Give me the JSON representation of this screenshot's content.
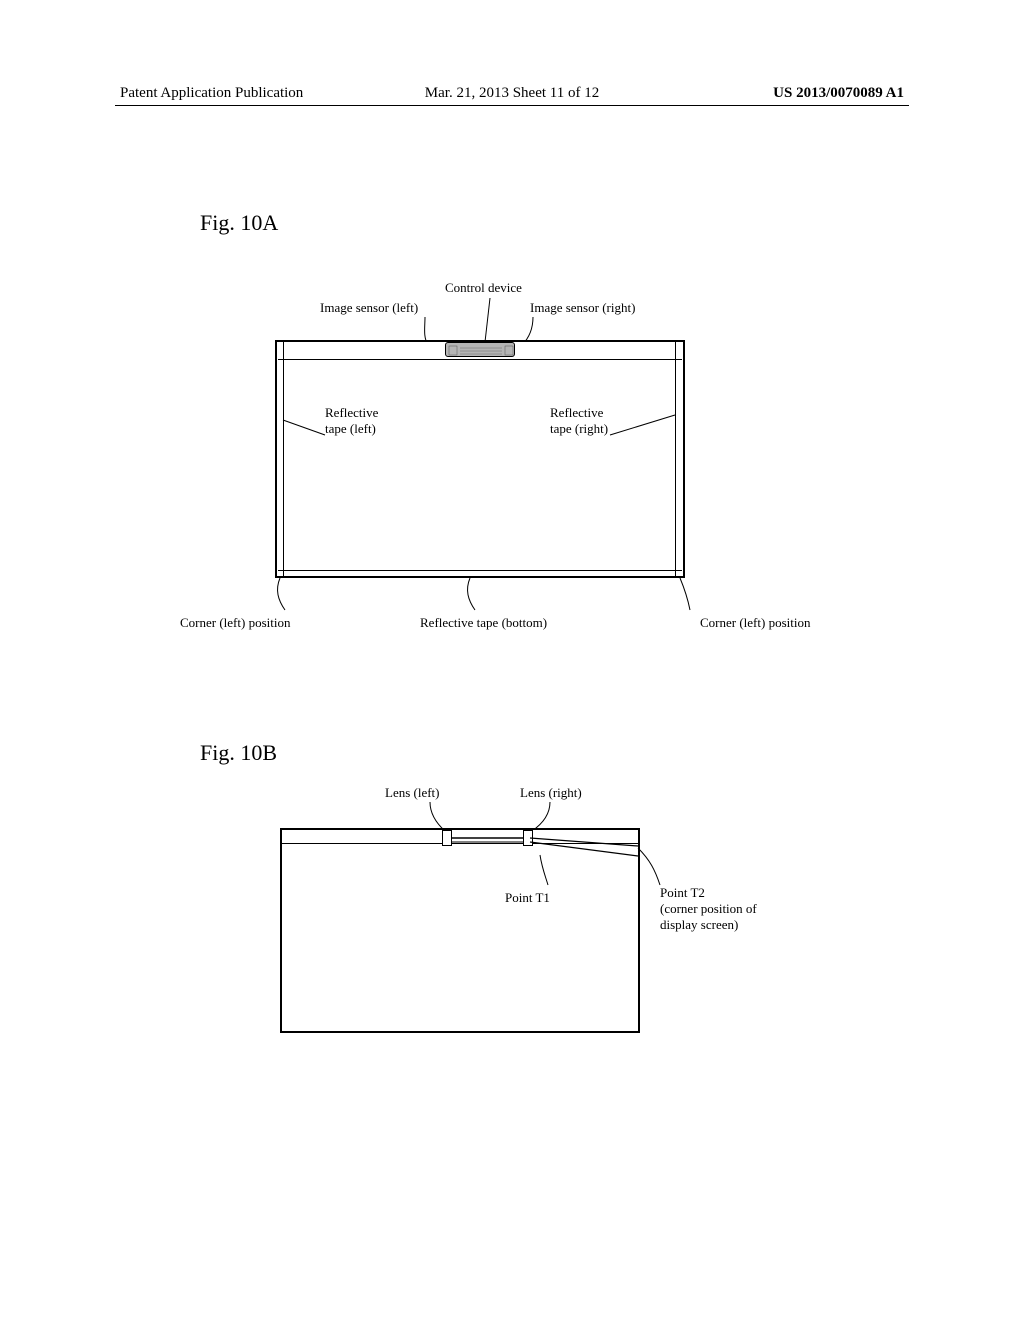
{
  "header": {
    "left": "Patent Application Publication",
    "center": "Mar. 21, 2013  Sheet 11 of 12",
    "right": "US 2013/0070089 A1"
  },
  "figA": {
    "title": "Fig. 10A",
    "labels": {
      "controlDevice": "Control device",
      "imageSensorLeft": "Image sensor (left)",
      "imageSensorRight": "Image sensor (right)",
      "reflectiveTapeLeft": "Reflective\ntape (left)",
      "reflectiveTapeRight": "Reflective\ntape (right)",
      "cornerLeftPosition": "Corner (left) position",
      "reflectiveTapeBottom": "Reflective tape (bottom)",
      "cornerRightPosition": "Corner (left) position"
    }
  },
  "figB": {
    "title": "Fig. 10B",
    "labels": {
      "lensLeft": "Lens (left)",
      "lensRight": "Lens (right)",
      "pointT1": "Point T1",
      "pointT2": "Point T2\n(corner position of\ndisplay screen)"
    }
  }
}
